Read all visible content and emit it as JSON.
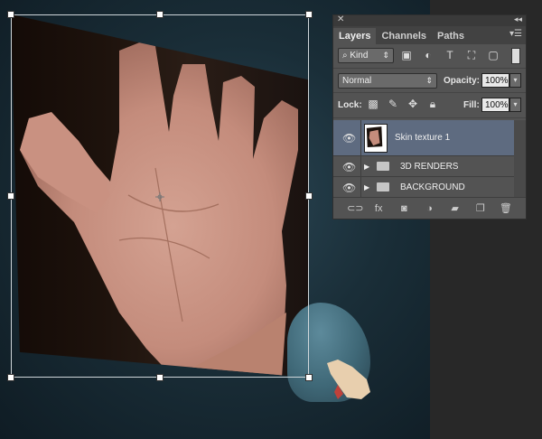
{
  "panel": {
    "tabs": [
      {
        "label": "Layers",
        "active": true
      },
      {
        "label": "Channels",
        "active": false
      },
      {
        "label": "Paths",
        "active": false
      }
    ],
    "filter_kind": "Kind",
    "blend_mode": "Normal",
    "opacity_label": "Opacity:",
    "opacity_value": "100%",
    "lock_label": "Lock:",
    "fill_label": "Fill:",
    "fill_value": "100%",
    "layers": [
      {
        "name": "Skin texture 1",
        "type": "layer",
        "selected": true,
        "icon": "eye-icon"
      },
      {
        "name": "3D RENDERS",
        "type": "group",
        "selected": false,
        "icon": "folder-icon"
      },
      {
        "name": "BACKGROUND",
        "type": "group",
        "selected": false,
        "icon": "folder-icon"
      }
    ],
    "bottom_icons": [
      "link-icon",
      "fx-icon",
      "mask-icon",
      "adjustment-icon",
      "new-group-icon",
      "new-layer-icon",
      "trash-icon"
    ],
    "fx_label": "fx"
  },
  "colors": {
    "panel_bg": "#535353",
    "selected_layer": "#5e6b80",
    "canvas_bg": "#1a2e38"
  }
}
